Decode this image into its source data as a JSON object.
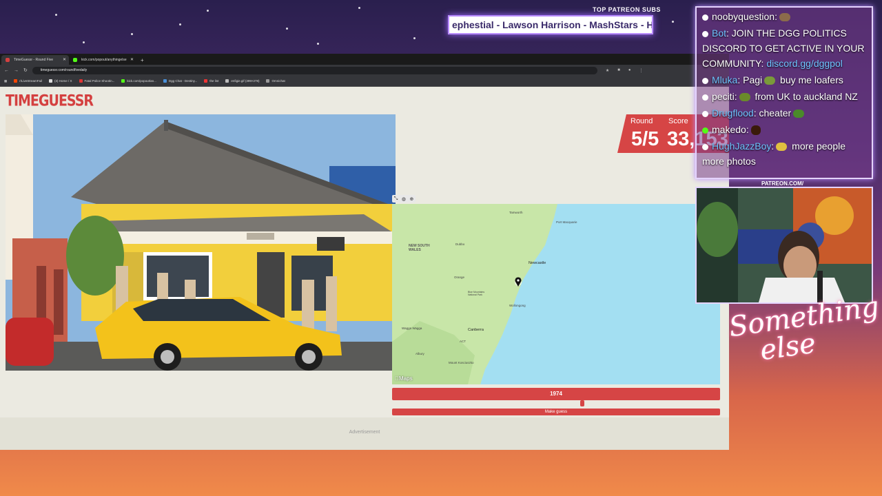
{
  "overlay": {
    "patreon_label": "TOP PATREON SUBS",
    "ticker_text": "ephestial - Lawson Harrison - MashStars - Hon",
    "patreon_url": "PATREON.COM/",
    "brand_line1": "Something",
    "brand_line2": "else"
  },
  "browser": {
    "tabs": [
      {
        "label": "TimeGuessr - Round Five",
        "active": true,
        "favicon_color": "#d44040"
      },
      {
        "label": "kick.com/popout/anythingelse",
        "active": false,
        "favicon_color": "#53fc18"
      }
    ],
    "new_tab": "+",
    "url": "timeguessr.com/roundfivedaily",
    "bookmarks": [
      {
        "label": "r/LiveStreamFail",
        "color": "#ff4500"
      },
      {
        "label": "(3) Home / X",
        "color": "#dddddd"
      },
      {
        "label": "Fatal Police Shootin...",
        "color": "#d33"
      },
      {
        "label": "kick.com/popout/an...",
        "color": "#53fc18"
      },
      {
        "label": "Dgg Chat - Destiny...",
        "color": "#4a90d9"
      },
      {
        "label": "the list",
        "color": "#e33"
      },
      {
        "label": "enfigie.gif (399×278)",
        "color": "#bbbbbb"
      },
      {
        "label": "Omnichat",
        "color": "#999999"
      }
    ]
  },
  "game": {
    "logo": "TIMEGUESSR",
    "round_label": "Round",
    "score_label": "Score",
    "round_value": "5/5",
    "score_value": "33,153",
    "year_value": "1974",
    "year_fraction": 0.58,
    "guess_button": "Make guess",
    "advertisement": "Advertisement",
    "map_brand": "Maps",
    "map_labels": {
      "nsw": "NEW SOUTH\nWALES",
      "tamworth": "Tamworth",
      "port_macquarie": "Port Macquarie",
      "dubbo": "Dubbo",
      "newcastle": "Newcastle",
      "orange": "Orange",
      "blue_mountains": "Blue Mountains\nNational Park",
      "wollongong": "Wollongong",
      "wagga": "Wagga Wagga",
      "act": "ACT",
      "canberra": "Canberra",
      "albury": "Albury",
      "kosciuszko": "Mount Kosciuszko"
    }
  },
  "chat": {
    "messages": [
      {
        "user": "noobyquestion",
        "user_color": "#ffffff",
        "text": ":",
        "emote_color": "#8b6b4b"
      },
      {
        "user": "Bot",
        "user_color": "#6fc3ff",
        "text": ": JOIN THE DGG POLITICS DISCORD TO GET ACTIVE IN YOUR COMMUNITY: ",
        "link": "discord.gg/dggpol"
      },
      {
        "user": "Mluka",
        "user_color": "#6fc3ff",
        "text": ": Pagi",
        "emote_color": "#7a9a3a",
        "text2": " buy me loafers"
      },
      {
        "user": "peciti",
        "user_color": "#ffffff",
        "text": ":",
        "emote_color": "#6a8a2a",
        "text2": " from UK to auckland NZ"
      },
      {
        "user": "Drugflood",
        "user_color": "#6fc3ff",
        "text": ": cheater",
        "emote_color": "#4a8a2a"
      },
      {
        "user": "makedo",
        "user_color": "#ffffff",
        "text": ":",
        "emote_color": "#3a1a0a"
      },
      {
        "user": "HughJazzBoy",
        "user_color": "#6fc3ff",
        "text": ":",
        "emote_color": "#e0c040",
        "text2": " more people more photos"
      }
    ]
  }
}
